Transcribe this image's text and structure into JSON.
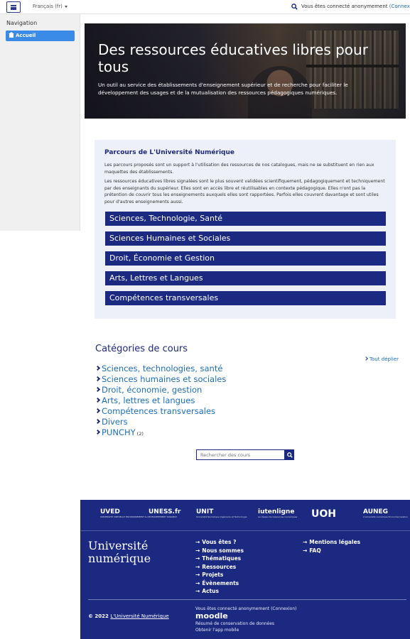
{
  "topbar": {
    "language": "Français (fr)",
    "login_text": "Vous êtes connecté anonymement",
    "login_link": "(Connexion)"
  },
  "sidebar": {
    "title": "Navigation",
    "items": [
      {
        "label": "Accueil"
      }
    ]
  },
  "hero": {
    "title": "Des ressources éducatives libres pour tous",
    "subtitle": "Un outil au service des établissements d'enseignement supérieur et de recherche pour faciliter le développement des usages et de la mutualisation des ressources pédagogiques numériques."
  },
  "parcours": {
    "title": "Parcours de L'Université Numérique",
    "p1": "Les parcours proposés sont un support à l'utilisation des ressources de nos catalogues, mais ne se substituent en rien aux maquettes des établissements.",
    "p2": "Les ressources éducatives libres signalées sont le plus souvent validées scientifiquement, pédagogiquement et techniquement par des enseignants du supérieur. Elles sont en accès libre et réutilisables en contexte pédagogique. Elles n'ont pas la prétention de couvrir tous les enseignements auxquels elles sont rapportées. Parfois elles couvrent davantage et sont utiles pour d'autres enseignements aussi.",
    "buttons": [
      {
        "label": "Sciences, Technologie, Santé"
      },
      {
        "label": "Sciences Humaines et Sociales"
      },
      {
        "label": "Droit, Économie et Gestion"
      },
      {
        "label": "Arts, Lettres et Langues"
      },
      {
        "label": "Compétences transversales"
      }
    ]
  },
  "categories": {
    "title": "Catégories de cours",
    "expand_all": "Tout déplier",
    "items": [
      {
        "label": "Sciences, technologies, santé"
      },
      {
        "label": "Sciences humaines et sociales"
      },
      {
        "label": "Droit, économie, gestion"
      },
      {
        "label": "Arts, lettres et langues"
      },
      {
        "label": "Compétences transversales"
      },
      {
        "label": "Divers"
      },
      {
        "label": "PUNCHY",
        "count": "(2)"
      }
    ],
    "search_placeholder": "Rechercher des cours"
  },
  "footer": {
    "logos": [
      {
        "label": "UVED",
        "sub": "UNIVERSITÉ VIRTUELLE ENVIRONNEMENT & DÉVELOPPEMENT DURABLE"
      },
      {
        "label": "UNESS.fr",
        "sub": ""
      },
      {
        "label": "UNIT",
        "sub": "Université Numérique Ingénierie et Technologie"
      },
      {
        "label": "iutenligne",
        "sub": "Le réseau de ressources numériques"
      },
      {
        "label": "UOH",
        "sub": ""
      },
      {
        "label": "AUNEG",
        "sub": "L'université numérique Économie Gestion"
      }
    ],
    "brand_line1": "Université",
    "brand_line2": "numérique",
    "links_col1": [
      {
        "label": "Vous êtes ?"
      },
      {
        "label": "Nous sommes"
      },
      {
        "label": "Thématiques"
      },
      {
        "label": "Ressources"
      },
      {
        "label": "Projets"
      },
      {
        "label": "Évènements"
      },
      {
        "label": "Actus"
      }
    ],
    "links_col2": [
      {
        "label": "Mentions légales"
      },
      {
        "label": "FAQ"
      }
    ],
    "copyright_prefix": "© 2022",
    "copyright_name": "L'Université Numérique",
    "login_text": "Vous êtes connecté anonymement (Connexion)",
    "moodle": "moodle",
    "data_retention": "Résumé de conservation de données",
    "mobile_app": "Obtenir l'app mobile"
  }
}
